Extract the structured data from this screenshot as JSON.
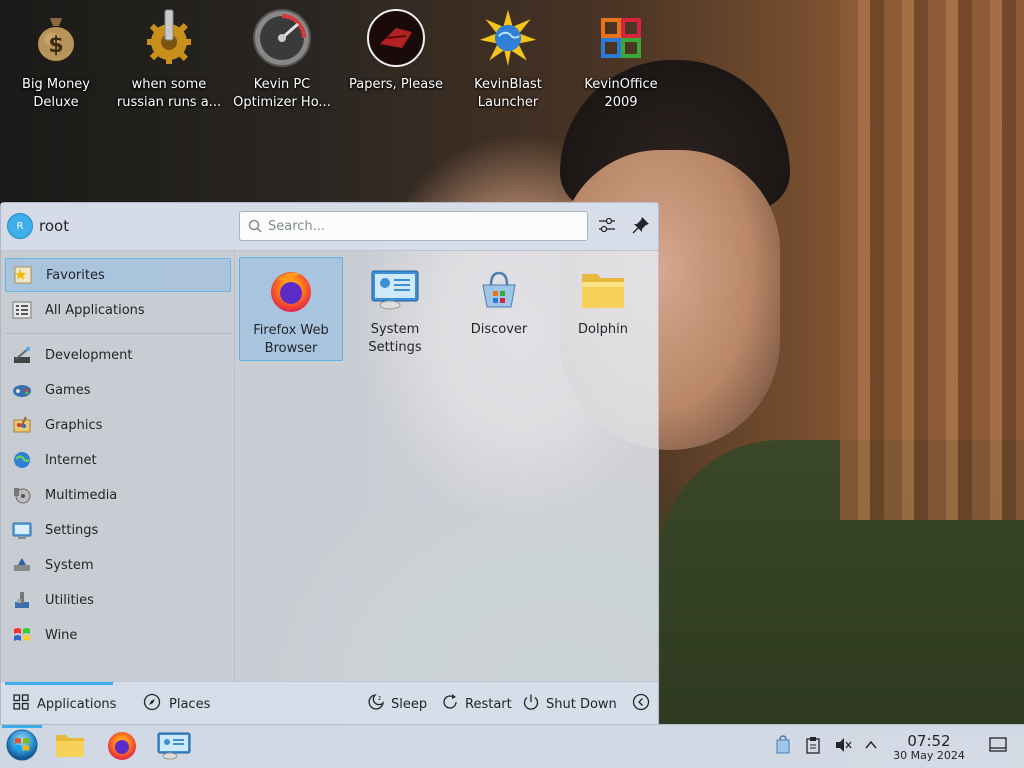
{
  "desktop": {
    "icons": [
      {
        "label": "Big Money\nDeluxe",
        "icon": "money-bag-icon"
      },
      {
        "label": "when some\nrussian runs a...",
        "icon": "gear-icon"
      },
      {
        "label": "Kevin PC\nOptimizer Ho...",
        "icon": "gauge-icon"
      },
      {
        "label": "Papers, Please",
        "icon": "papers-please-icon"
      },
      {
        "label": "KevinBlast\nLauncher",
        "icon": "globe-star-icon"
      },
      {
        "label": "KevinOffice\n2009",
        "icon": "office-logo-icon"
      }
    ]
  },
  "launcher": {
    "user": {
      "name": "root",
      "initial": "R"
    },
    "search": {
      "placeholder": "Search...",
      "value": ""
    },
    "categories": [
      {
        "label": "Favorites",
        "icon": "favorites-icon",
        "active": true
      },
      {
        "label": "All Applications",
        "icon": "grid-icon"
      },
      {
        "label": "Development",
        "icon": "development-icon"
      },
      {
        "label": "Games",
        "icon": "games-icon"
      },
      {
        "label": "Graphics",
        "icon": "graphics-icon"
      },
      {
        "label": "Internet",
        "icon": "internet-icon"
      },
      {
        "label": "Multimedia",
        "icon": "multimedia-icon"
      },
      {
        "label": "Settings",
        "icon": "settings-icon"
      },
      {
        "label": "System",
        "icon": "system-icon"
      },
      {
        "label": "Utilities",
        "icon": "utilities-icon"
      },
      {
        "label": "Wine",
        "icon": "wine-icon"
      }
    ],
    "favorites": [
      {
        "label": "Firefox Web\nBrowser",
        "icon": "firefox-icon",
        "active": true
      },
      {
        "label": "System\nSettings",
        "icon": "system-settings-icon"
      },
      {
        "label": "Discover",
        "icon": "discover-icon"
      },
      {
        "label": "Dolphin",
        "icon": "folder-icon"
      }
    ],
    "footer": {
      "applications": "Applications",
      "places": "Places",
      "sleep": "Sleep",
      "restart": "Restart",
      "shutdown": "Shut Down"
    }
  },
  "taskbar": {
    "time": "07:52",
    "date": "30 May 2024"
  },
  "colors": {
    "accent": "#3daee9",
    "panel": "#d6deea"
  }
}
